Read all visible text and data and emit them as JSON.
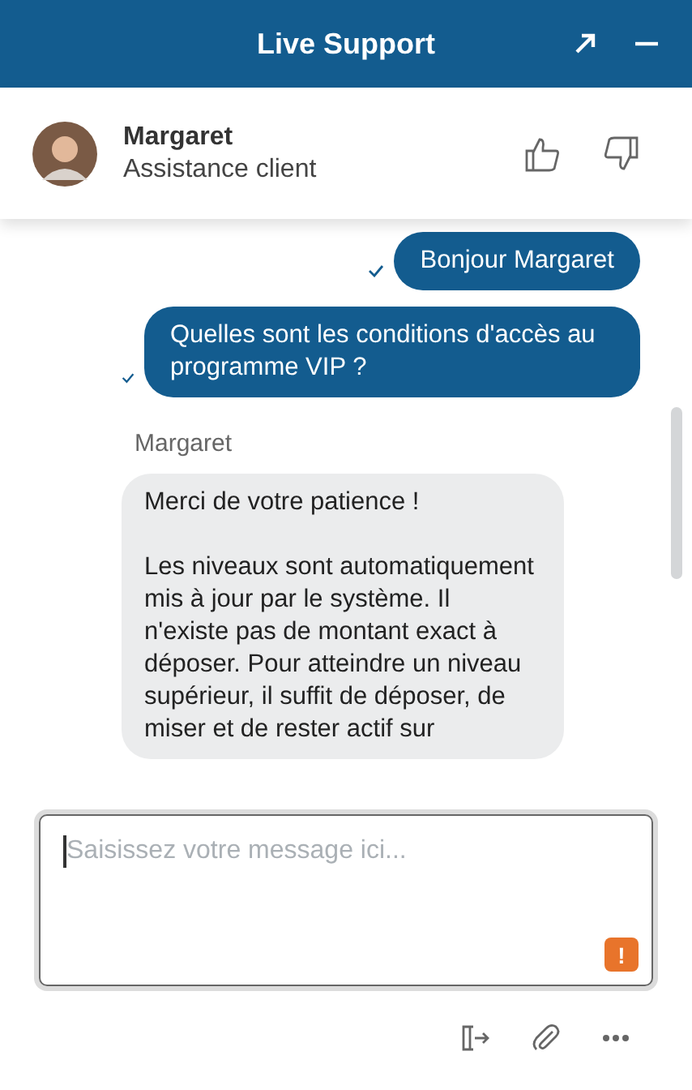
{
  "window": {
    "title": "Live Support"
  },
  "agent": {
    "name": "Margaret",
    "role": "Assistance client"
  },
  "messages": [
    {
      "kind": "sent",
      "delivered": true,
      "paragraphs": [
        "Bonjour Margaret"
      ]
    },
    {
      "kind": "sent",
      "delivered": true,
      "paragraphs": [
        "Quelles sont les conditions d'accès au programme VIP ?"
      ]
    },
    {
      "kind": "received",
      "sender": "Margaret",
      "paragraphs": [
        "Merci de votre patience !",
        "Les niveaux sont automatiquement mis à jour par le système. Il n'existe pas de montant exact à déposer. Pour atteindre un niveau supérieur, il suffit de déposer, de miser et de rester actif sur"
      ]
    }
  ],
  "composer": {
    "placeholder": "Saisissez votre message ici...",
    "warning": "!"
  }
}
